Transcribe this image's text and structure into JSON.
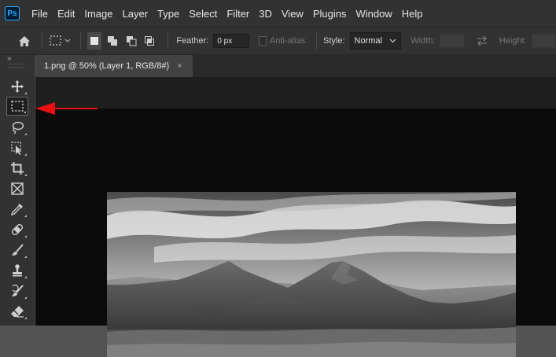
{
  "app": {
    "logo_text": "Ps"
  },
  "menu": [
    "File",
    "Edit",
    "Image",
    "Layer",
    "Type",
    "Select",
    "Filter",
    "3D",
    "View",
    "Plugins",
    "Window",
    "Help"
  ],
  "options": {
    "feather_label": "Feather:",
    "feather_value": "0 px",
    "antialias_label": "Anti-alias",
    "style_label": "Style:",
    "style_value": "Normal",
    "width_label": "Width:",
    "height_label": "Height:"
  },
  "document_tab": {
    "title": "1.png @ 50% (Layer 1, RGB/8#)",
    "close": "×"
  },
  "toolbar": {
    "collapse": "»",
    "tools": [
      {
        "name": "move-tool",
        "icon": "move-icon"
      },
      {
        "name": "rectangular-marquee-tool",
        "icon": "marquee-icon",
        "active": true
      },
      {
        "name": "lasso-tool",
        "icon": "lasso-icon"
      },
      {
        "name": "object-selection-tool",
        "icon": "object-selection-icon"
      },
      {
        "name": "crop-tool",
        "icon": "crop-icon"
      },
      {
        "name": "frame-tool",
        "icon": "frame-icon"
      },
      {
        "name": "eyedropper-tool",
        "icon": "eyedropper-icon"
      },
      {
        "name": "spot-healing-tool",
        "icon": "bandage-icon"
      },
      {
        "name": "brush-tool",
        "icon": "brush-icon"
      },
      {
        "name": "clone-stamp-tool",
        "icon": "stamp-icon"
      },
      {
        "name": "history-brush-tool",
        "icon": "history-brush-icon"
      },
      {
        "name": "eraser-tool",
        "icon": "eraser-icon"
      }
    ]
  },
  "colors": {
    "annotation_arrow": "#e81010",
    "menubar_bg": "#323232",
    "canvas_bg": "#0b0b0b"
  }
}
